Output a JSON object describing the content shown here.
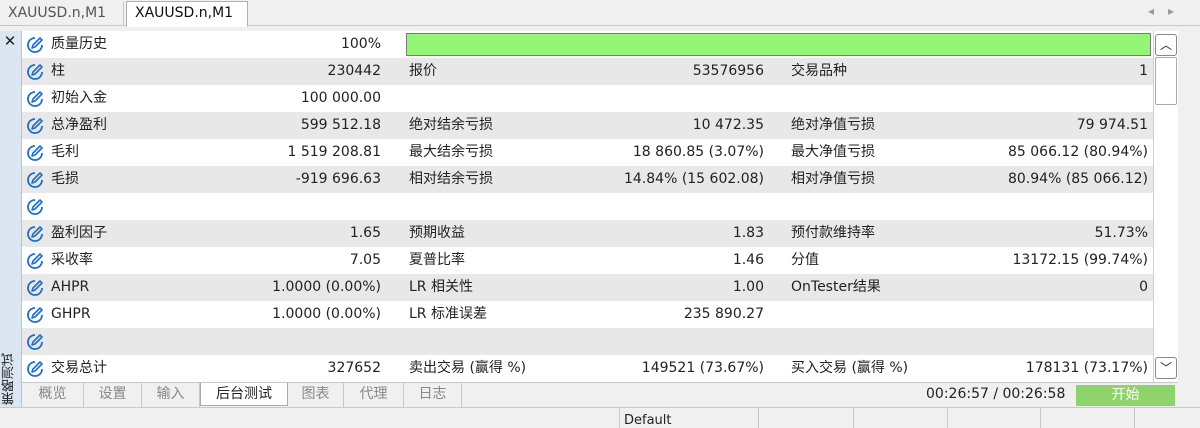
{
  "chart_tabs": [
    "XAUUSD.n,M1",
    "XAUUSD.n,M1"
  ],
  "side": {
    "close": "✕",
    "title": "策略测试"
  },
  "quality": {
    "label": "质量历史",
    "value": "100%",
    "fill_fraction": 1.0,
    "color": "#95f576"
  },
  "report_rows": [
    {
      "l1": "柱",
      "v1": "230442",
      "l2": "报价",
      "v2": "53576956",
      "l3": "交易品种",
      "v3": "1"
    },
    {
      "l1": "初始入金",
      "v1": "100 000.00",
      "l2": "",
      "v2": "",
      "l3": "",
      "v3": ""
    },
    {
      "l1": "总净盈利",
      "v1": "599 512.18",
      "l2": "绝对结余亏损",
      "v2": "10 472.35",
      "l3": "绝对净值亏损",
      "v3": "79 974.51"
    },
    {
      "l1": "毛利",
      "v1": "1 519 208.81",
      "l2": "最大结余亏损",
      "v2": "18 860.85 (3.07%)",
      "l3": "最大净值亏损",
      "v3": "85 066.12 (80.94%)"
    },
    {
      "l1": "毛损",
      "v1": "-919 696.63",
      "l2": "相对结余亏损",
      "v2": "14.84% (15 602.08)",
      "l3": "相对净值亏损",
      "v3": "80.94% (85 066.12)"
    },
    {
      "l1": "",
      "v1": "",
      "l2": "",
      "v2": "",
      "l3": "",
      "v3": ""
    },
    {
      "l1": "盈利因子",
      "v1": "1.65",
      "l2": "预期收益",
      "v2": "1.83",
      "l3": "预付款维持率",
      "v3": "51.73%"
    },
    {
      "l1": "采收率",
      "v1": "7.05",
      "l2": "夏普比率",
      "v2": "1.46",
      "l3": "分值",
      "v3": "13172.15 (99.74%)"
    },
    {
      "l1": "AHPR",
      "v1": "1.0000 (0.00%)",
      "l2": "LR 相关性",
      "v2": "1.00",
      "l3": "OnTester结果",
      "v3": "0"
    },
    {
      "l1": "GHPR",
      "v1": "1.0000 (0.00%)",
      "l2": "LR 标准误差",
      "v2": "235 890.27",
      "l3": "",
      "v3": ""
    },
    {
      "l1": "",
      "v1": "",
      "l2": "",
      "v2": "",
      "l3": "",
      "v3": ""
    },
    {
      "l1": "交易总计",
      "v1": "327652",
      "l2": "卖出交易 (赢得 %)",
      "v2": "149521 (73.67%)",
      "l3": "买入交易 (赢得 %)",
      "v3": "178131 (73.17%)"
    }
  ],
  "tester_tabs": [
    "概览",
    "设置",
    "输入",
    "后台测试",
    "图表",
    "代理",
    "日志"
  ],
  "active_tester_tab": "后台测试",
  "timer": "00:26:57 / 00:26:58",
  "start_label": "开始",
  "status_bar": {
    "profile": "Default"
  },
  "icons": {
    "row_icon": "edit-pencil-icon",
    "scroll_up": "chevron-up-icon",
    "scroll_down": "chevron-down-icon"
  }
}
